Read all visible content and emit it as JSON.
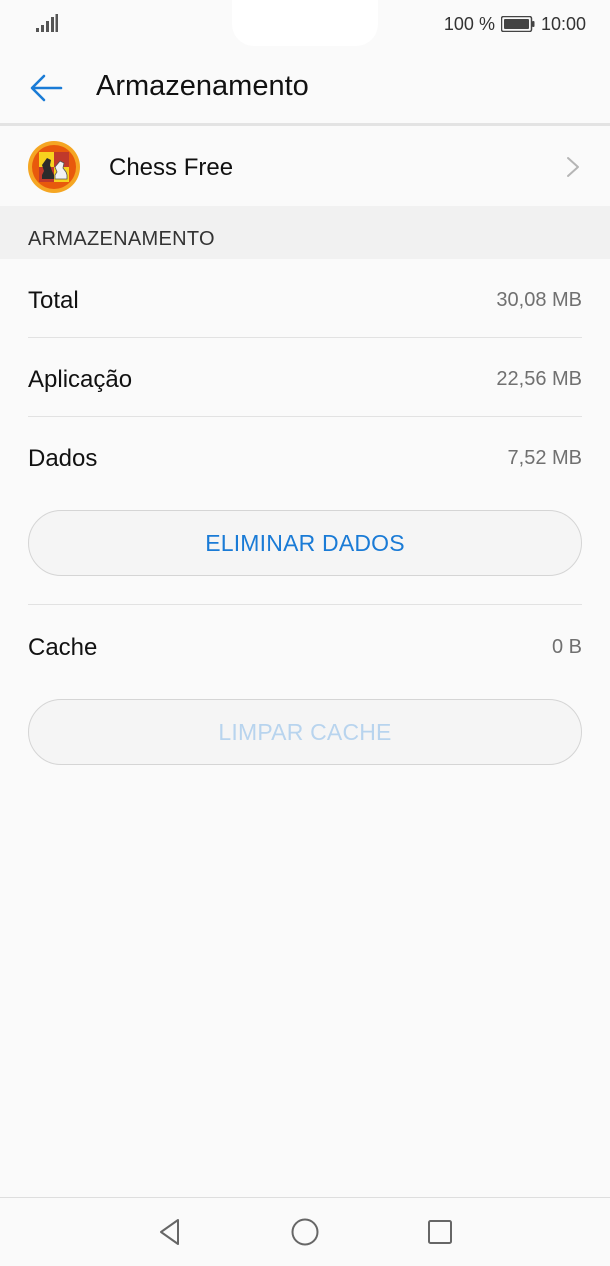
{
  "status_bar": {
    "battery_percent": "100 %",
    "time": "10:00",
    "icons": [
      "signal-icon",
      "battery-icon"
    ]
  },
  "header": {
    "title": "Armazenamento",
    "back_icon": "arrow-back-icon"
  },
  "app": {
    "name": "Chess Free",
    "icon": "chess-app-icon",
    "chevron_icon": "chevron-right-icon"
  },
  "storage": {
    "section_title": "ARMAZENAMENTO",
    "total_label": "Total",
    "total_value": "30,08 MB",
    "app_label": "Aplicação",
    "app_value": "22,56 MB",
    "data_label": "Dados",
    "data_value": "7,52 MB",
    "clear_data_button": "ELIMINAR DADOS",
    "cache_label": "Cache",
    "cache_value": "0 B",
    "clear_cache_button": "LIMPAR CACHE"
  },
  "nav_bar": {
    "icons": [
      "back-triangle-icon",
      "home-circle-icon",
      "recents-square-icon"
    ]
  },
  "colors": {
    "accent": "#1a7bd6",
    "accent_disabled": "#b8d4ee",
    "background": "#fafafa",
    "section_background": "#f1f1f1",
    "secondary_text": "#707070"
  }
}
